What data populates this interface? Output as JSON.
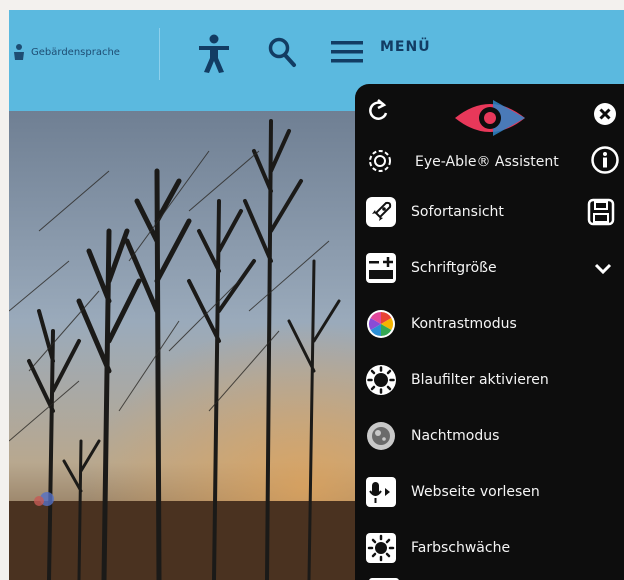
{
  "topbar": {
    "language_label": "Gebärdensprache",
    "menu_label": "MENÜ",
    "colors": {
      "bar": "#5bb9df",
      "text": "#123c63"
    }
  },
  "panel": {
    "title": "Eye-Able® Assistent",
    "items": [
      {
        "label": "Sofortansicht",
        "icon": "rocket-icon"
      },
      {
        "label": "Schriftgröße",
        "icon": "text-size-icon"
      },
      {
        "label": "Kontrastmodus",
        "icon": "contrast-icon"
      },
      {
        "label": "Blaufilter aktivieren",
        "icon": "blue-filter-icon"
      },
      {
        "label": "Nachtmodus",
        "icon": "night-mode-icon"
      },
      {
        "label": "Webseite vorlesen",
        "icon": "read-aloud-icon"
      },
      {
        "label": "Farbschwäche",
        "icon": "color-weakness-icon"
      }
    ],
    "colors": {
      "background": "#0d0d0d",
      "logo": "#e8385a",
      "logo_accent": "#2e86c9"
    }
  }
}
